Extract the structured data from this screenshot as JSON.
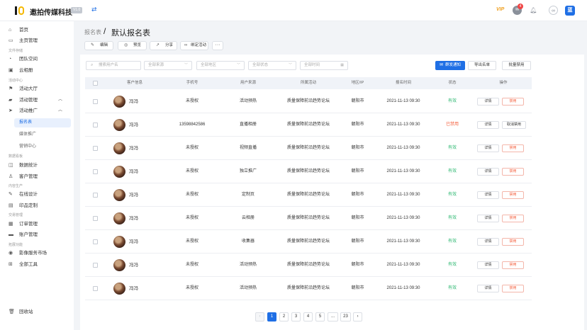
{
  "header": {
    "org_name": "邀拍传媒科技",
    "version_badge": "V1.0",
    "vip_label": "VIP",
    "notification_count": "4",
    "user_avatar_text": "蓝"
  },
  "sidebar": {
    "items": [
      {
        "label": "首页",
        "icon": "home-icon"
      },
      {
        "label": "主页管理",
        "icon": "monitor-icon"
      },
      {
        "label": "团队空间",
        "icon": "team-icon"
      },
      {
        "label": "云相册",
        "icon": "image-icon"
      },
      {
        "label": "活动大厅",
        "icon": "flag-icon"
      },
      {
        "label": "活动管理",
        "icon": "folder-icon"
      },
      {
        "label": "活动推广",
        "icon": "send-icon"
      },
      {
        "label": "数据统计",
        "icon": "chart-icon"
      },
      {
        "label": "客户管理",
        "icon": "user-icon"
      },
      {
        "label": "在线设计",
        "icon": "brush-icon"
      },
      {
        "label": "印品定制",
        "icon": "print-icon"
      },
      {
        "label": "订单管理",
        "icon": "order-icon"
      },
      {
        "label": "账户管理",
        "icon": "account-icon"
      },
      {
        "label": "影像服务市场",
        "icon": "camera-icon"
      },
      {
        "label": "全部工具",
        "icon": "grid-icon"
      },
      {
        "label": "回收站",
        "icon": "trash-icon"
      }
    ],
    "sub_items": [
      "报名表",
      "媒体推广",
      "营销中心"
    ],
    "groups": [
      "文件存储",
      "活动中心",
      "数据看板",
      "内容生产",
      "交易管理",
      "拓展功能"
    ]
  },
  "breadcrumb": {
    "parent": "报名表",
    "separator": "/",
    "title": "默认报名表"
  },
  "toolbar": {
    "edit": "编辑",
    "preview": "预览",
    "share": "分享",
    "bind": "绑定活动",
    "more": "···"
  },
  "filters": {
    "search_placeholder": "搜索用户名",
    "source": "全部来源",
    "region": "全部地区",
    "status": "全部状态",
    "time": "全部时间"
  },
  "actions": {
    "notify": "群发通知",
    "export": "导出名单",
    "batch_ban": "批量禁用"
  },
  "table": {
    "headers": [
      "客户信息",
      "手机号",
      "用户来源",
      "所属活动",
      "地区/IP",
      "报名时间",
      "状态",
      "操作"
    ],
    "rows": [
      {
        "name": "冯冯",
        "phone": "未授权",
        "source": "活动预热",
        "activity": "质量保障前沿趋势论坛",
        "region": "朝阳市",
        "time": "2021-11-13 09:30",
        "status": "有效",
        "status_type": "ok",
        "detail": "详情",
        "op": "禁用",
        "op_type": "ban"
      },
      {
        "name": "冯冯",
        "phone": "13598842586",
        "source": "直播相册",
        "activity": "质量保障前沿趋势论坛",
        "region": "朝阳市",
        "time": "2021-11-13 09:30",
        "status": "已禁用",
        "status_type": "ban",
        "detail": "详情",
        "op": "取消禁用",
        "op_type": "unban"
      },
      {
        "name": "冯冯",
        "phone": "未授权",
        "source": "视频直播",
        "activity": "质量保障前沿趋势论坛",
        "region": "朝阳市",
        "time": "2021-11-13 09:30",
        "status": "有效",
        "status_type": "ok",
        "detail": "详情",
        "op": "禁用",
        "op_type": "ban"
      },
      {
        "name": "冯冯",
        "phone": "未授权",
        "source": "独立推广",
        "activity": "质量保障前沿趋势论坛",
        "region": "朝阳市",
        "time": "2021-11-13 09:30",
        "status": "有效",
        "status_type": "ok",
        "detail": "详情",
        "op": "禁用",
        "op_type": "ban"
      },
      {
        "name": "冯冯",
        "phone": "未授权",
        "source": "定制页",
        "activity": "质量保障前沿趋势论坛",
        "region": "朝阳市",
        "time": "2021-11-13 09:30",
        "status": "有效",
        "status_type": "ok",
        "detail": "详情",
        "op": "禁用",
        "op_type": "ban"
      },
      {
        "name": "冯冯",
        "phone": "未授权",
        "source": "云相册",
        "activity": "质量保障前沿趋势论坛",
        "region": "朝阳市",
        "time": "2021-11-13 09:30",
        "status": "有效",
        "status_type": "ok",
        "detail": "详情",
        "op": "禁用",
        "op_type": "ban"
      },
      {
        "name": "冯冯",
        "phone": "未授权",
        "source": "收集器",
        "activity": "质量保障前沿趋势论坛",
        "region": "朝阳市",
        "time": "2021-11-13 09:30",
        "status": "有效",
        "status_type": "ok",
        "detail": "详情",
        "op": "禁用",
        "op_type": "ban"
      },
      {
        "name": "冯冯",
        "phone": "未授权",
        "source": "活动预热",
        "activity": "质量保障前沿趋势论坛",
        "region": "朝阳市",
        "time": "2021-11-13 09:30",
        "status": "有效",
        "status_type": "ok",
        "detail": "详情",
        "op": "禁用",
        "op_type": "ban"
      },
      {
        "name": "冯冯",
        "phone": "未授权",
        "source": "活动预热",
        "activity": "质量保障前沿趋势论坛",
        "region": "朝阳市",
        "time": "2021-11-13 09:30",
        "status": "有效",
        "status_type": "ok",
        "detail": "详情",
        "op": "禁用",
        "op_type": "ban"
      }
    ]
  },
  "pagination": {
    "prev": "‹",
    "pages": [
      "1",
      "2",
      "3",
      "4",
      "5",
      "...",
      "23"
    ],
    "next": "›",
    "current": "1"
  },
  "colors": {
    "primary": "#1f6fe5",
    "ok": "#2eb872",
    "danger": "#f5613f",
    "vip": "#f0a020"
  }
}
